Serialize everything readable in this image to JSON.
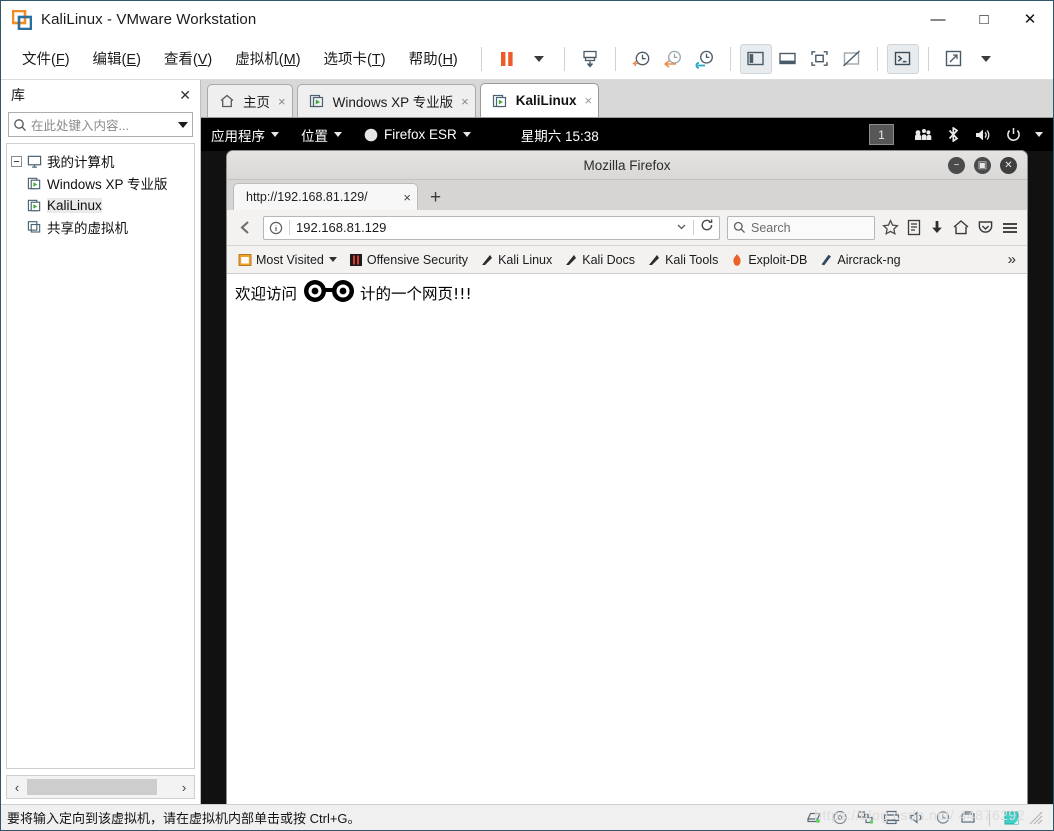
{
  "window": {
    "title": "KaliLinux - VMware Workstation",
    "logo_icon": "vmware-logo-icon",
    "controls": {
      "minimize": "—",
      "maximize": "□",
      "close": "✕"
    }
  },
  "menubar": {
    "items": [
      {
        "label": "文件",
        "accel": "F"
      },
      {
        "label": "编辑",
        "accel": "E"
      },
      {
        "label": "查看",
        "accel": "V"
      },
      {
        "label": "虚拟机",
        "accel": "M"
      },
      {
        "label": "选项卡",
        "accel": "T"
      },
      {
        "label": "帮助",
        "accel": "H"
      }
    ],
    "toolbar": [
      {
        "name": "suspend-button",
        "icon": "pause-icon"
      },
      {
        "name": "power-dropdown",
        "icon": "chevron-down-icon"
      },
      {
        "name": "snapshot-button",
        "icon": "snapshot-icon"
      },
      {
        "name": "take-snapshot-button",
        "icon": "clock-plus-icon"
      },
      {
        "name": "revert-snapshot-button",
        "icon": "clock-back-icon"
      },
      {
        "name": "manage-snapshots-button",
        "icon": "clock-wrench-icon"
      },
      {
        "name": "show-library-button",
        "icon": "panel-left-icon"
      },
      {
        "name": "show-thumbnail-bar-button",
        "icon": "panel-bottom-icon"
      },
      {
        "name": "show-console-view-button",
        "icon": "expand-box-icon"
      },
      {
        "name": "hide-view-button",
        "icon": "box-slash-icon"
      },
      {
        "name": "console-button",
        "icon": "terminal-icon"
      },
      {
        "name": "fullscreen-button",
        "icon": "fullscreen-icon"
      },
      {
        "name": "fullscreen-dropdown",
        "icon": "chevron-down-icon"
      }
    ]
  },
  "sidebar": {
    "header": "库",
    "close_icon": "close-icon",
    "search": {
      "placeholder": "在此处键入内容...",
      "value": "",
      "icon": "search-icon",
      "dropdown_icon": "chevron-down-icon"
    },
    "tree": [
      {
        "label": "我的计算机",
        "icon": "computer-icon",
        "level": 0,
        "expander": true,
        "selected": false
      },
      {
        "label": "Windows XP 专业版",
        "icon": "vm-icon",
        "level": 1,
        "expander": false,
        "selected": false
      },
      {
        "label": "KaliLinux",
        "icon": "vm-icon",
        "level": 1,
        "expander": false,
        "selected": true
      },
      {
        "label": "共享的虚拟机",
        "icon": "shared-vm-icon",
        "level": 0,
        "expander": false,
        "selected": false
      }
    ],
    "scrollbar": {
      "left_arrow": "‹",
      "right_arrow": "›"
    }
  },
  "tabs": [
    {
      "label": "主页",
      "icon": "home-icon",
      "active": false,
      "close_icon": "×"
    },
    {
      "label": "Windows XP 专业版",
      "icon": "vm-icon",
      "active": false,
      "close_icon": "×"
    },
    {
      "label": "KaliLinux",
      "icon": "vm-icon",
      "active": true,
      "close_icon": "×"
    }
  ],
  "guest": {
    "panel": {
      "applications": "应用程序",
      "places": "位置",
      "firefox": "Firefox ESR",
      "firefox_icon": "firefox-icon",
      "clock": "星期六 15:38",
      "workspace": "1",
      "tray": [
        {
          "name": "users-icon",
          "glyph": "users"
        },
        {
          "name": "bluetooth-icon",
          "glyph": "bluetooth"
        },
        {
          "name": "volume-icon",
          "glyph": "volume"
        },
        {
          "name": "power-icon",
          "glyph": "power"
        },
        {
          "name": "chevron-down-icon",
          "glyph": "chevron"
        }
      ]
    },
    "firefox": {
      "window_title": "Mozilla Firefox",
      "controls": {
        "minimize": "−",
        "maximize": "▣",
        "close": "✕"
      },
      "tab": {
        "label": "http://192.168.81.129/",
        "close": "×"
      },
      "new_tab": "+",
      "nav": {
        "back_icon": "back-arrow-icon",
        "info_icon": "page-info-icon",
        "url": "192.168.81.129",
        "url_dropdown_icon": "chevron-down-icon",
        "reload_icon": "reload-icon",
        "search_placeholder": "Search",
        "search_icon": "search-icon",
        "bookmark_icon": "star-icon",
        "library_icon": "library-icon",
        "downloads_icon": "download-icon",
        "home_icon": "home-icon",
        "pocket_icon": "pocket-icon",
        "menu_icon": "hamburger-menu-icon"
      },
      "bookmarks": [
        {
          "label": "Most Visited",
          "icon": "most-visited-icon",
          "has_chevron": true
        },
        {
          "label": "Offensive Security",
          "icon": "offensive-security-icon",
          "has_chevron": false
        },
        {
          "label": "Kali Linux",
          "icon": "kali-dragon-icon",
          "has_chevron": false
        },
        {
          "label": "Kali Docs",
          "icon": "kali-dragon-icon",
          "has_chevron": false
        },
        {
          "label": "Kali Tools",
          "icon": "kali-dragon-icon",
          "has_chevron": false
        },
        {
          "label": "Exploit-DB",
          "icon": "exploit-db-icon",
          "has_chevron": false
        },
        {
          "label": "Aircrack-ng",
          "icon": "aircrack-icon",
          "has_chevron": false
        }
      ],
      "bookmarks_overflow": "»",
      "page": {
        "text_before": "欢迎访问",
        "text_after": "计的一个网页!!!",
        "overlay_icon": "glasses-overlay-icon"
      }
    }
  },
  "statusbar": {
    "message": "要将输入定向到该虚拟机，请在虚拟机内部单击或按 Ctrl+G。",
    "watermark": "https://blog.csdn.net/ 44876292",
    "devices": [
      {
        "name": "hard-disk-icon"
      },
      {
        "name": "cd-dvd-icon"
      },
      {
        "name": "network-adapter-icon"
      },
      {
        "name": "printer-icon"
      },
      {
        "name": "sound-card-icon"
      },
      {
        "name": "usb-icon"
      },
      {
        "name": "removable-device-icon"
      },
      {
        "name": "message-log-icon"
      }
    ]
  }
}
